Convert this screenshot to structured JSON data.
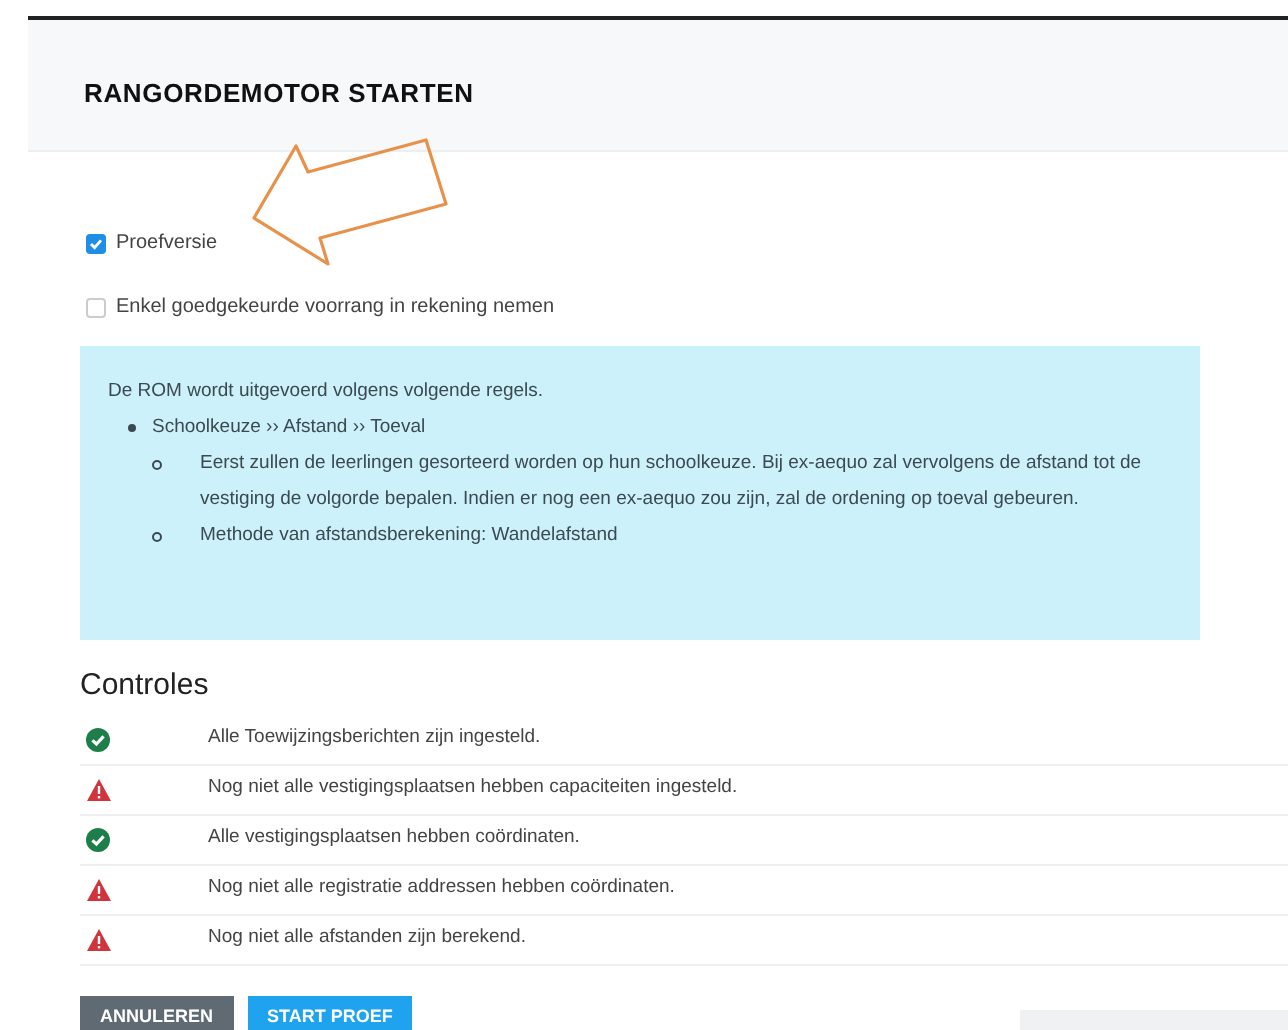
{
  "title": "RANGORDEMOTOR STARTEN",
  "options": [
    {
      "label": "Proefversie",
      "checked": true
    },
    {
      "label": "Enkel goedgekeurde voorrang in rekening nemen",
      "checked": false
    }
  ],
  "info": {
    "intro": "De ROM wordt uitgevoerd volgens volgende regels.",
    "rule": "Schoolkeuze ›› Afstand ›› Toeval",
    "details": [
      "Eerst zullen de leerlingen gesorteerd worden op hun schoolkeuze. Bij ex-aequo zal vervolgens de afstand tot de vestiging de volgorde bepalen. Indien er nog een ex-aequo zou zijn, zal de ordening op toeval gebeuren.",
      "Methode van afstandsberekening: Wandelafstand"
    ]
  },
  "checks_title": "Controles",
  "checks": [
    {
      "kind": "ok",
      "text": "Alle Toewijzingsberichten zijn ingesteld."
    },
    {
      "kind": "warning",
      "text": "Nog niet alle vestigingsplaatsen hebben capaciteiten ingesteld."
    },
    {
      "kind": "ok",
      "text": "Alle vestigingsplaatsen hebben coördinaten."
    },
    {
      "kind": "warning",
      "text": "Nog niet alle registratie addressen hebben coördinaten."
    },
    {
      "kind": "warning",
      "text": "Nog niet alle afstanden zijn berekend."
    }
  ],
  "buttons": [
    {
      "kind": "secondary",
      "label": "ANNULEREN"
    },
    {
      "kind": "primary",
      "label": "START PROEF"
    }
  ]
}
